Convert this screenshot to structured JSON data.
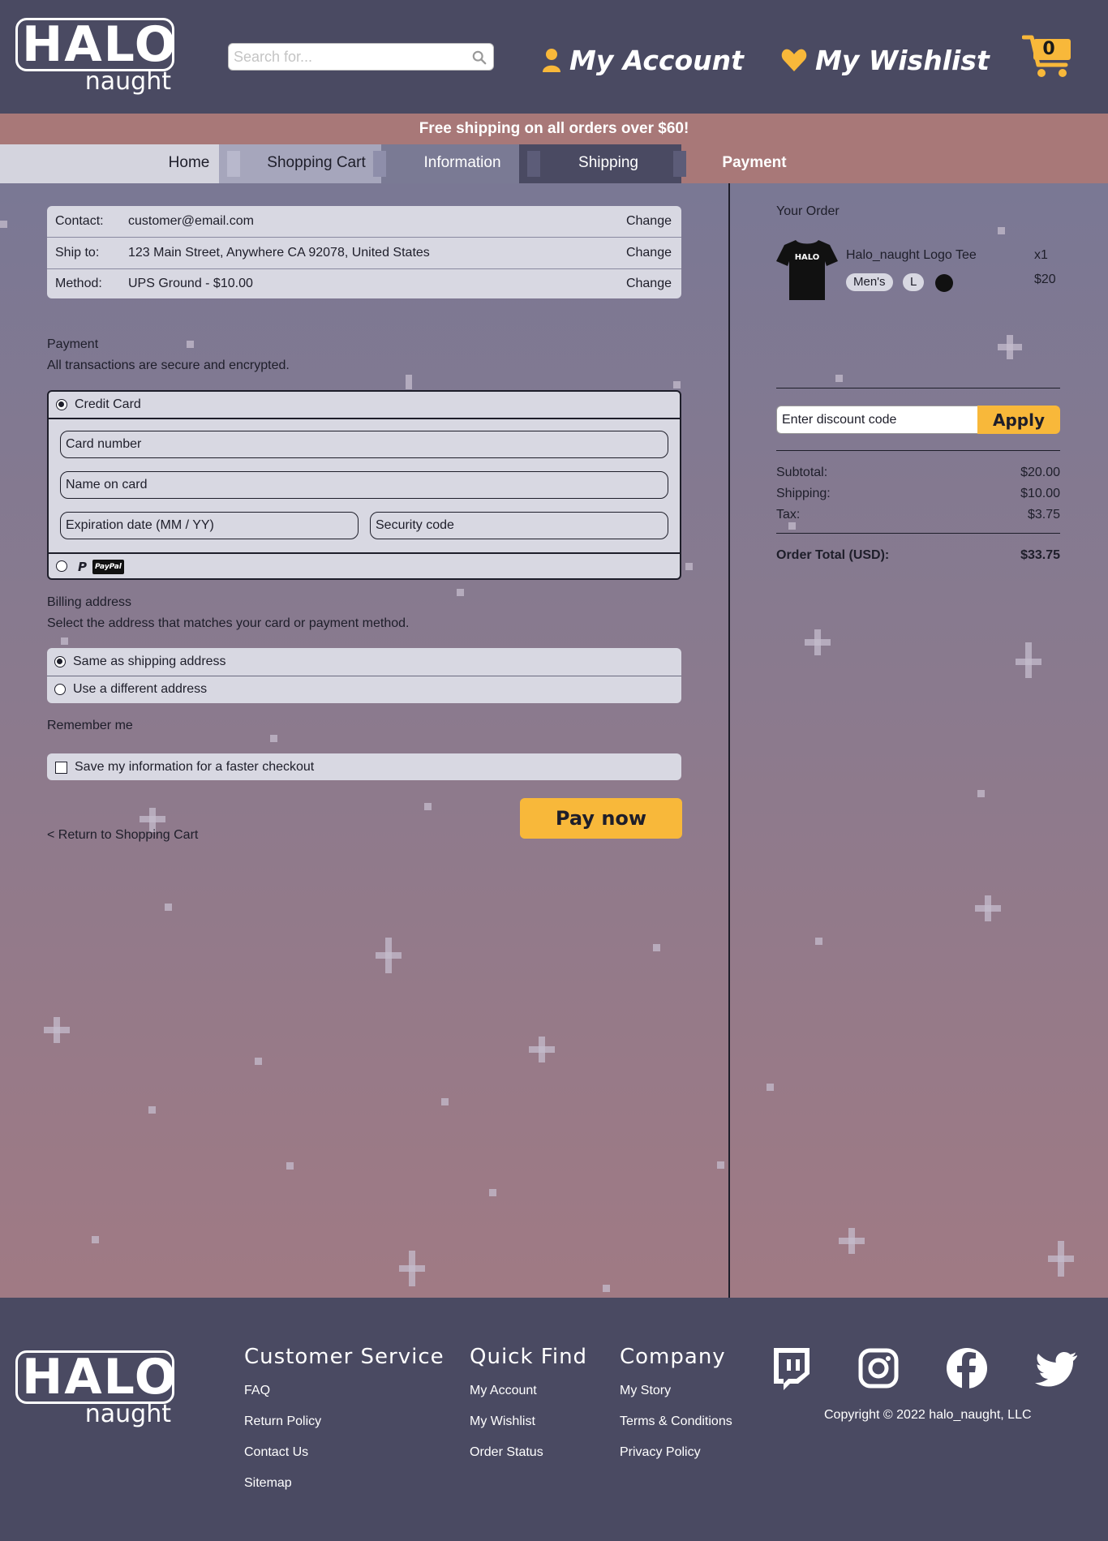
{
  "header": {
    "logo_text": "HALO",
    "logo_sub": "naught",
    "search_placeholder": "Search for...",
    "account_label": "My Account",
    "wishlist_label": "My Wishlist",
    "cart_count": "0"
  },
  "promo": "Free shipping on all orders over $60!",
  "breadcrumb": [
    "Home",
    "Shopping Cart",
    "Information",
    "Shipping",
    "Payment"
  ],
  "summary": [
    {
      "label": "Contact:",
      "value": "customer@email.com",
      "action": "Change"
    },
    {
      "label": "Ship to:",
      "value": "123 Main Street, Anywhere CA 92078, United States",
      "action": "Change"
    },
    {
      "label": "Method:",
      "value": "UPS Ground - $10.00",
      "action": "Change"
    }
  ],
  "payment": {
    "title": "Payment",
    "subtitle": "All transactions are secure and encrypted.",
    "credit_card_label": "Credit Card",
    "card_number_placeholder": "Card number",
    "name_placeholder": "Name on card",
    "expiration_placeholder": "Expiration date (MM / YY)",
    "security_placeholder": "Security code",
    "paypal_badge": "PayPal"
  },
  "billing": {
    "title": "Billing address",
    "subtitle": "Select the address that matches your card or payment method.",
    "same_label": "Same as shipping address",
    "different_label": "Use a different address"
  },
  "remember": {
    "title": "Remember me",
    "save_label": "Save my information for a faster checkout"
  },
  "pay_button": "Pay now",
  "return_link": "< Return to Shopping Cart",
  "order": {
    "title": "Your Order",
    "item_name": "Halo_naught Logo Tee",
    "item_qty": "x1",
    "item_price": "$20",
    "tee_logo": "HALO",
    "tag_gender": "Men's",
    "tag_size": "L",
    "swatch_color": "#111111",
    "discount_placeholder": "Enter discount code",
    "apply_label": "Apply",
    "subtotal_label": "Subtotal:",
    "subtotal": "$20.00",
    "shipping_label": "Shipping:",
    "shipping": "$10.00",
    "tax_label": "Tax:",
    "tax": "$3.75",
    "total_label": "Order Total (USD):",
    "total": "$33.75"
  },
  "footer": {
    "customer_service": {
      "title": "Customer Service",
      "links": [
        "FAQ",
        "Return Policy",
        "Contact Us",
        "Sitemap"
      ]
    },
    "quick_find": {
      "title": "Quick Find",
      "links": [
        "My Account",
        "My Wishlist",
        "Order Status"
      ]
    },
    "company": {
      "title": "Company",
      "links": [
        "My Story",
        "Terms & Conditions",
        "Privacy Policy"
      ]
    },
    "social_icons": [
      "twitch-icon",
      "instagram-icon",
      "facebook-icon",
      "twitter-icon"
    ],
    "copyright": "Copyright © 2022 halo_naught, LLC"
  },
  "colors": {
    "header_bg": "#4a4a62",
    "promo_bg": "#a87878",
    "accent": "#f8b83a",
    "panel": "#d8d8e2"
  }
}
